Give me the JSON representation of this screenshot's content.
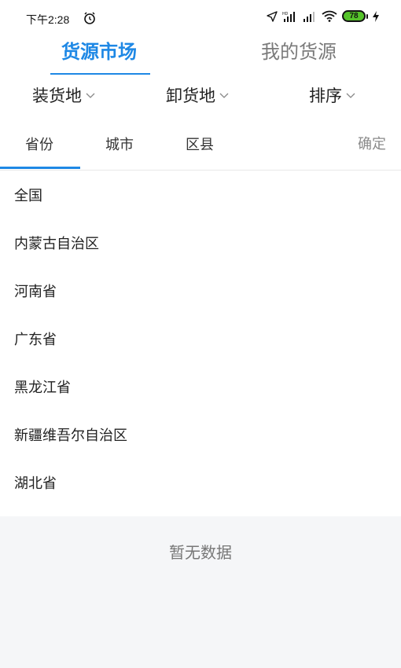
{
  "status_bar": {
    "time": "下午2:28",
    "battery_level": "78",
    "icons": [
      "alarm-icon",
      "location-arrow-icon",
      "signal-hd-icon",
      "signal-icon",
      "wifi-icon",
      "battery-icon",
      "charging-icon"
    ]
  },
  "top_tabs": {
    "active": "货源市场",
    "inactive": "我的货源",
    "accent_color": "#1e88e5"
  },
  "filters": {
    "loading": "装货地",
    "unloading": "卸货地",
    "sort": "排序"
  },
  "level_tabs": {
    "province": "省份",
    "city": "城市",
    "district": "区县",
    "confirm": "确定"
  },
  "provinces": [
    "全国",
    "内蒙古自治区",
    "河南省",
    "广东省",
    "黑龙江省",
    "新疆维吾尔自治区",
    "湖北省"
  ],
  "empty": {
    "text": "暂无数据"
  }
}
